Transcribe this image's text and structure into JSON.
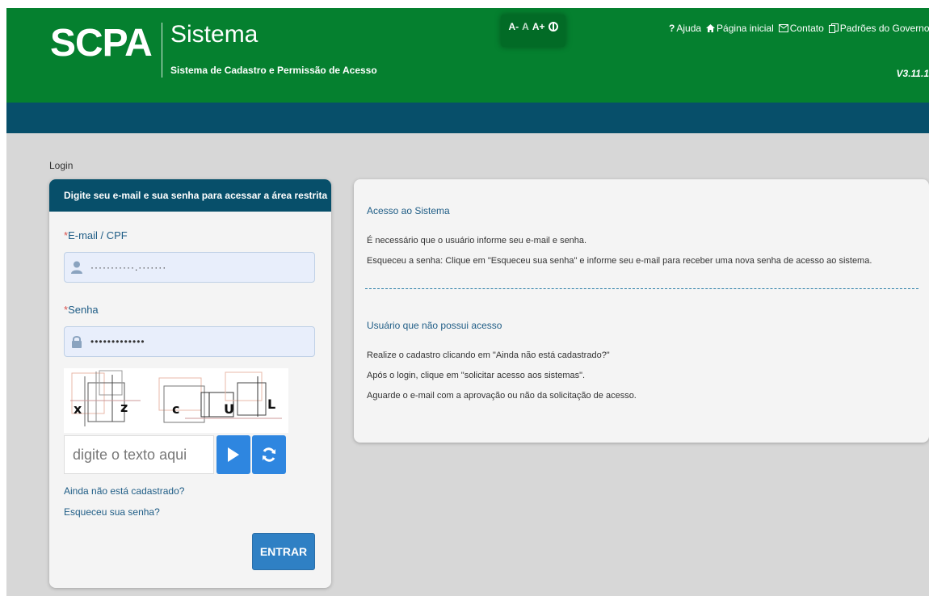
{
  "header": {
    "logo": "SCPA",
    "title": "Sistema",
    "subtitle": "Sistema de Cadastro e Permissão de Acesso",
    "font_controls": [
      "A-",
      "A",
      "A+"
    ],
    "links": [
      {
        "icon": "?",
        "label": "Ajuda"
      },
      {
        "icon": "home-icon",
        "label": "Página inicial"
      },
      {
        "icon": "mail-icon",
        "label": "Contato"
      },
      {
        "icon": "docs-icon",
        "label": "Padrões do Governo"
      }
    ],
    "version": "V3.11.1"
  },
  "breadcrumb": "Login",
  "login": {
    "heading": "Digite seu e-mail e sua senha para acessar a área restrita",
    "email_label": "E-mail / CPF",
    "required_mark": "*",
    "email_value": "···········.·······",
    "password_label": "Senha",
    "password_value": "•••••••••••••",
    "captcha_letters": [
      "x",
      "z",
      "c",
      "U",
      "L"
    ],
    "captcha_placeholder": "digite o texto aqui",
    "link_register": "Ainda não está cadastrado?",
    "link_forgot": "Esqueceu sua senha?",
    "submit_label": "ENTRAR"
  },
  "info": {
    "section1_title": "Acesso ao Sistema",
    "section1_lines": [
      "É necessário que o usuário informe seu e-mail e senha.",
      "Esqueceu a senha: Clique em \"Esqueceu sua senha\" e informe seu e-mail para receber uma nova senha de acesso ao sistema."
    ],
    "section2_title": "Usuário que não possui acesso",
    "section2_lines": [
      "Realize o cadastro clicando em \"Ainda não está cadastrado?\"",
      "Após o login, clique em \"solicitar acesso aos sistemas\".",
      "Aguarde o e-mail com a aprovação ou não da solicitação de acesso."
    ]
  },
  "colors": {
    "header_green": "#05802f",
    "bar_blue": "#074f6a",
    "link_blue": "#1f5d86",
    "button_blue": "#2f80c4"
  }
}
